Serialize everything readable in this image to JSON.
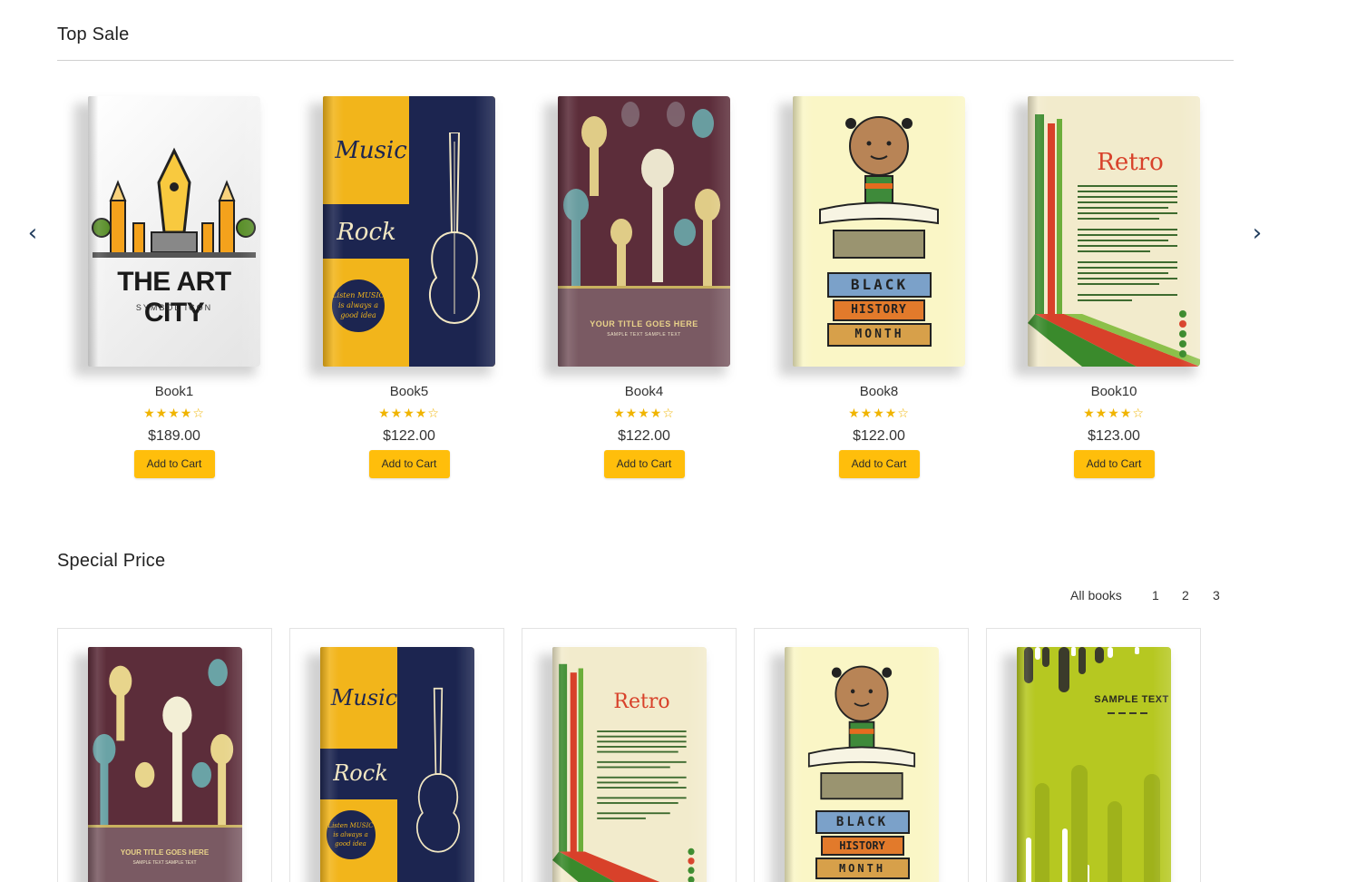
{
  "top_sale": {
    "title": "Top Sale",
    "books": [
      {
        "name": "Book1",
        "rating": 4,
        "rating_max": 5,
        "stars": "★★★★☆",
        "price": "$189.00",
        "button": "Add to Cart",
        "cover": {
          "style": "art-city",
          "title": "THE ART CITY",
          "subtitle": "SYMBOL ICON"
        }
      },
      {
        "name": "Book5",
        "rating": 4,
        "rating_max": 5,
        "stars": "★★★★☆",
        "price": "$122.00",
        "button": "Add to Cart",
        "cover": {
          "style": "music",
          "word1": "Music",
          "word2": "Rock",
          "badge": "Listen MUSIC is always a good idea"
        }
      },
      {
        "name": "Book4",
        "rating": 4,
        "rating_max": 5,
        "stars": "★★★★☆",
        "price": "$122.00",
        "button": "Add to Cart",
        "cover": {
          "style": "hands",
          "title": "YOUR TITLE GOES HERE",
          "subtitle": "SAMPLE TEXT SAMPLE TEXT"
        }
      },
      {
        "name": "Book8",
        "rating": 4,
        "rating_max": 5,
        "stars": "★★★★☆",
        "price": "$122.00",
        "button": "Add to Cart",
        "cover": {
          "style": "kid",
          "line1": "BLACK",
          "line2": "HISTORY",
          "line3": "MONTH"
        }
      },
      {
        "name": "Book10",
        "rating": 4,
        "rating_max": 5,
        "stars": "★★★★☆",
        "price": "$123.00",
        "button": "Add to Cart",
        "cover": {
          "style": "retro",
          "title": "Retro"
        }
      }
    ]
  },
  "special_price": {
    "title": "Special Price",
    "pager": {
      "all": "All books",
      "pages": [
        "1",
        "2",
        "3"
      ]
    },
    "books": [
      {
        "cover": {
          "style": "hands",
          "title": "YOUR TITLE GOES HERE",
          "subtitle": "SAMPLE TEXT SAMPLE TEXT"
        }
      },
      {
        "cover": {
          "style": "music",
          "word1": "Music",
          "word2": "Rock",
          "badge": "Listen MUSIC is always a good idea"
        }
      },
      {
        "cover": {
          "style": "retro",
          "title": "Retro"
        }
      },
      {
        "cover": {
          "style": "kid",
          "line1": "BLACK",
          "line2": "HISTORY",
          "line3": "MONTH"
        }
      },
      {
        "cover": {
          "style": "green",
          "title": "SAMPLE TEXT"
        }
      }
    ]
  },
  "nav": {
    "prev_icon": "chevron-left-icon",
    "next_icon": "chevron-right-icon",
    "prev_glyph": "‹",
    "next_glyph": "›"
  },
  "colors": {
    "accent": "#ffbe0b",
    "star": "#f0b400",
    "arrow": "#1f3b5c"
  }
}
